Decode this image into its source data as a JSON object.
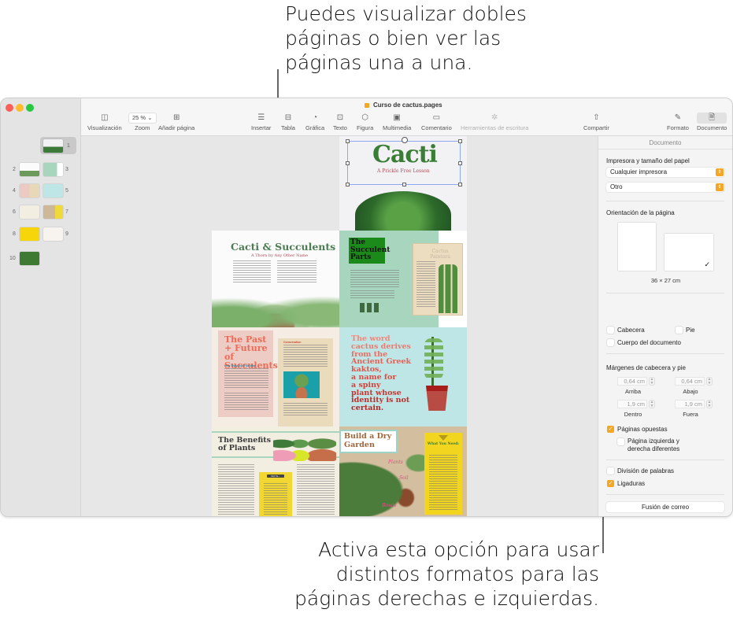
{
  "callouts": {
    "top": "Puedes visualizar dobles páginas o bien ver las páginas una a una.",
    "bottom": "Activa esta opción para usar distintos formatos para las páginas derechas e izquierdas."
  },
  "window": {
    "title": "Curso de cactus.pages",
    "title_icon": "pages-document-icon"
  },
  "toolbar": {
    "items": [
      {
        "id": "view",
        "label": "Visualización",
        "icon": "sidebar-view-icon"
      },
      {
        "id": "zoom",
        "label": "Zoom",
        "value": "25 %",
        "icon": "chevron-down-icon"
      },
      {
        "id": "add-page",
        "label": "Añadir página",
        "icon": "plus-square-icon"
      },
      {
        "id": "insert",
        "label": "Insertar",
        "icon": "insert-list-icon"
      },
      {
        "id": "table",
        "label": "Tabla",
        "icon": "table-icon"
      },
      {
        "id": "chart",
        "label": "Gráfica",
        "icon": "chart-icon"
      },
      {
        "id": "text",
        "label": "Texto",
        "icon": "text-box-icon"
      },
      {
        "id": "shape",
        "label": "Figura",
        "icon": "shape-icon"
      },
      {
        "id": "media",
        "label": "Multimedia",
        "icon": "media-icon"
      },
      {
        "id": "comment",
        "label": "Comentario",
        "icon": "comment-icon"
      },
      {
        "id": "writing-tools",
        "label": "Herramientas de escritura",
        "icon": "writing-tools-icon",
        "disabled": true
      },
      {
        "id": "share",
        "label": "Compartir",
        "icon": "share-icon"
      },
      {
        "id": "format",
        "label": "Formato",
        "icon": "paintbrush-icon"
      },
      {
        "id": "document",
        "label": "Documento",
        "icon": "document-icon",
        "active": true
      }
    ]
  },
  "thumbnails": {
    "selected": 1,
    "pages": [
      "1",
      "2",
      "3",
      "4",
      "5",
      "6",
      "7",
      "8",
      "9",
      "10"
    ]
  },
  "pages": {
    "p1": {
      "title": "Cacti",
      "subtitle": "A Prickle Free Lesson"
    },
    "p2": {
      "title": "Cacti & Succulents",
      "subtitle": "A Thorn by Any Other Name"
    },
    "p3": {
      "title": "The Succulent Parts",
      "poster_title": "Cactus Paintura"
    },
    "p4": {
      "title": "The Past + Future of Succulents",
      "subhead": "How They Got This Way",
      "sidebar_head": "Conservation"
    },
    "p5": {
      "quote_line1": "The word",
      "quote_line2": "cactus derives",
      "quote_line3": "from the",
      "quote_line4": "Ancient Greek",
      "quote_line5": "kaktos,",
      "quote_line6": "a name for",
      "quote_line7": "a spiny",
      "quote_line8": "plant whose",
      "quote_line9": "identity is not",
      "quote_line10": "certain."
    },
    "p6": {
      "title": "The Benefits of Plants",
      "box_head": "Did Ya..."
    },
    "p7": {
      "title": "Build a Dry Garden",
      "box_title": "What You Need:",
      "label_plants": "Plants",
      "label_soil": "Soil",
      "label_bowls": "Bowls"
    }
  },
  "inspector": {
    "header": "Documento",
    "printer_section": "Impresora y tamaño del papel",
    "printer_value": "Cualquier impresora",
    "paper_value": "Otro",
    "orientation_section": "Orientación de la página",
    "orientation_selected": "landscape",
    "page_size": "36 × 27 cm",
    "header_checkbox": {
      "label": "Cabecera",
      "checked": false
    },
    "footer_checkbox": {
      "label": "Pie",
      "checked": false
    },
    "body_checkbox": {
      "label": "Cuerpo del documento",
      "checked": false
    },
    "margins_section": "Márgenes de cabecera y pie",
    "margins": {
      "top": {
        "label": "Arriba",
        "value": "0,64 cm"
      },
      "bottom": {
        "label": "Abajo",
        "value": "0,64 cm"
      },
      "inside": {
        "label": "Dentro",
        "value": "1,9 cm"
      },
      "outside": {
        "label": "Fuera",
        "value": "1,9 cm"
      }
    },
    "facing_pages": {
      "label": "Páginas opuestas",
      "checked": true
    },
    "different_lr": {
      "label_line1": "Página izquierda y",
      "label_line2": "derecha diferentes",
      "checked": false
    },
    "hyphenation": {
      "label": "División de palabras",
      "checked": false
    },
    "ligatures": {
      "label": "Ligaduras",
      "checked": true
    },
    "mail_merge": "Fusión de correo"
  },
  "colors": {
    "accent": "#f5a623",
    "close": "#fe5f57",
    "minimize": "#febc2e",
    "zoom": "#28c840"
  }
}
